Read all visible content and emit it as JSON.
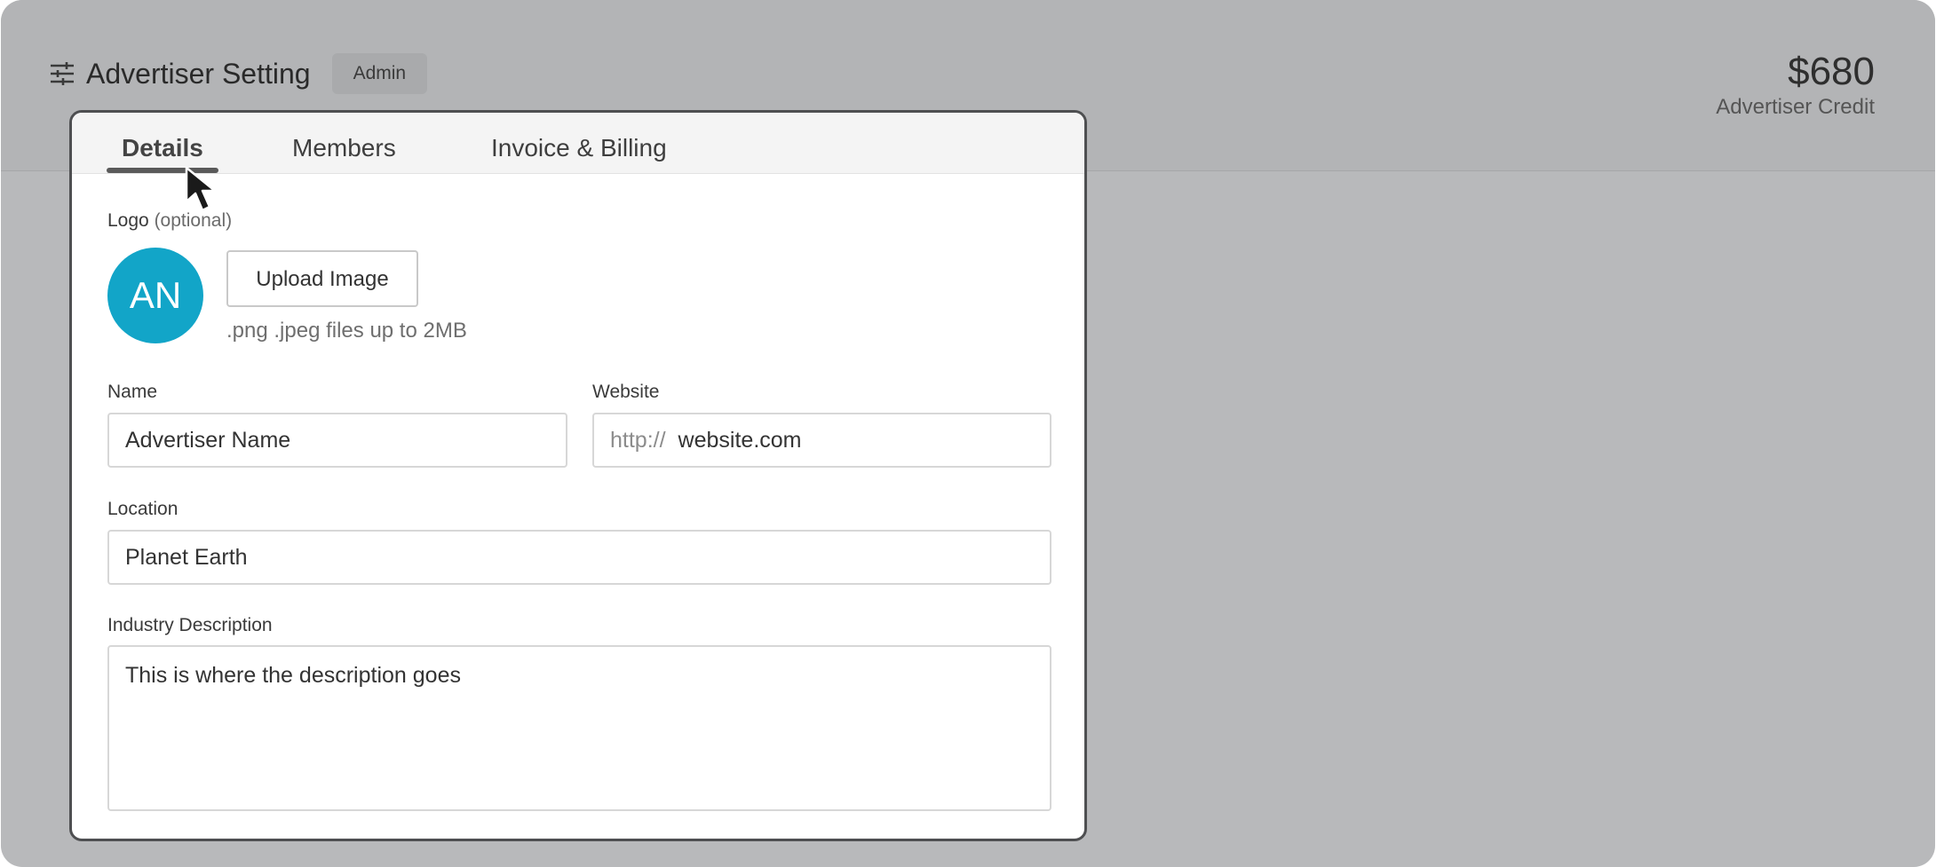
{
  "header": {
    "title": "Advertiser Setting",
    "role_badge": "Admin",
    "credit_amount": "$680",
    "credit_label": "Advertiser Credit"
  },
  "tabs": [
    {
      "label": "Details",
      "active": true
    },
    {
      "label": "Members",
      "active": false
    },
    {
      "label": "Invoice & Billing",
      "active": false
    }
  ],
  "form": {
    "logo": {
      "label": "Logo",
      "optional": "(optional)",
      "avatar_initials": "AN",
      "upload_button": "Upload Image",
      "hint": ".png .jpeg files up to 2MB"
    },
    "name": {
      "label": "Name",
      "value": "Advertiser Name"
    },
    "website": {
      "label": "Website",
      "prefix": "http://",
      "value": "website.com"
    },
    "location": {
      "label": "Location",
      "value": "Planet Earth"
    },
    "industry_description": {
      "label": "Industry Description",
      "value": "This is where the description goes"
    }
  },
  "colors": {
    "avatar_bg": "#12a5c8",
    "overlay": "#b8b9bb"
  },
  "icons": {
    "settings": "tune-icon",
    "pointer": "cursor-arrow-icon"
  }
}
